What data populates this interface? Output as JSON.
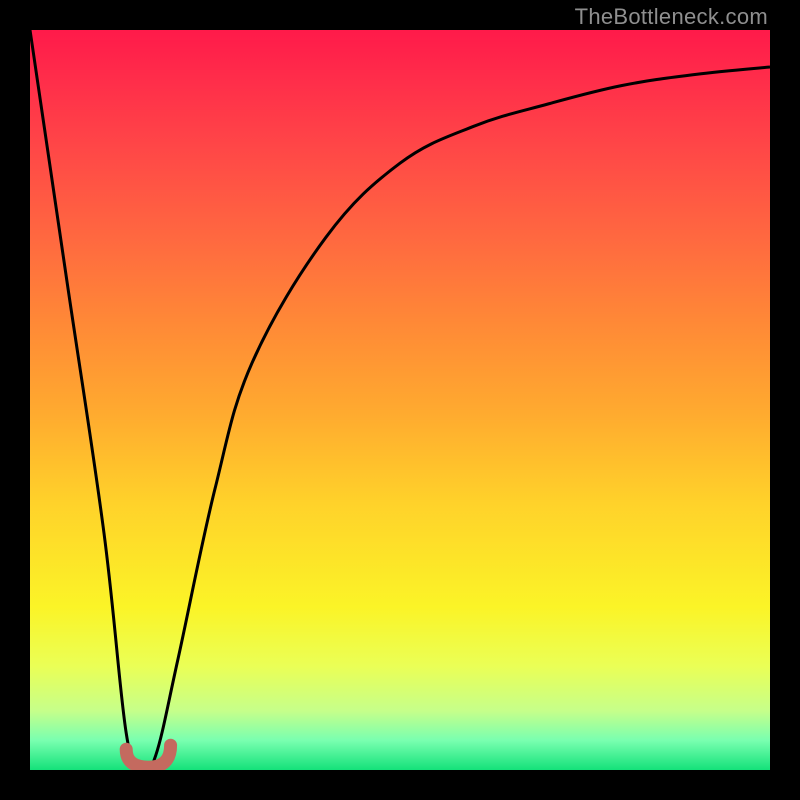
{
  "watermark": {
    "text": "TheBottleneck.com"
  },
  "chart_data": {
    "type": "line",
    "title": "",
    "xlabel": "",
    "ylabel": "",
    "xlim": [
      0,
      100
    ],
    "ylim": [
      0,
      100
    ],
    "grid": false,
    "legend": false,
    "series": [
      {
        "name": "bottleneck-curve",
        "x": [
          0,
          5,
          10,
          13,
          15,
          17,
          20,
          25,
          30,
          40,
          50,
          60,
          70,
          80,
          90,
          100
        ],
        "values": [
          100,
          66,
          32,
          5,
          0,
          2,
          15,
          38,
          55,
          72,
          82,
          87,
          90,
          92.5,
          94,
          95
        ]
      }
    ],
    "sweet_spot_marker": {
      "x_range": [
        13,
        19
      ],
      "y": 2,
      "color": "#c46a5f",
      "stroke_width_px": 13
    },
    "background_gradient": {
      "direction": "top-to-bottom",
      "stops": [
        {
          "pos": 0.0,
          "color": "#ff1a4a"
        },
        {
          "pos": 0.5,
          "color": "#ffab2f"
        },
        {
          "pos": 0.8,
          "color": "#fbf427"
        },
        {
          "pos": 0.96,
          "color": "#79ffb0"
        },
        {
          "pos": 1.0,
          "color": "#14e27a"
        }
      ]
    }
  }
}
